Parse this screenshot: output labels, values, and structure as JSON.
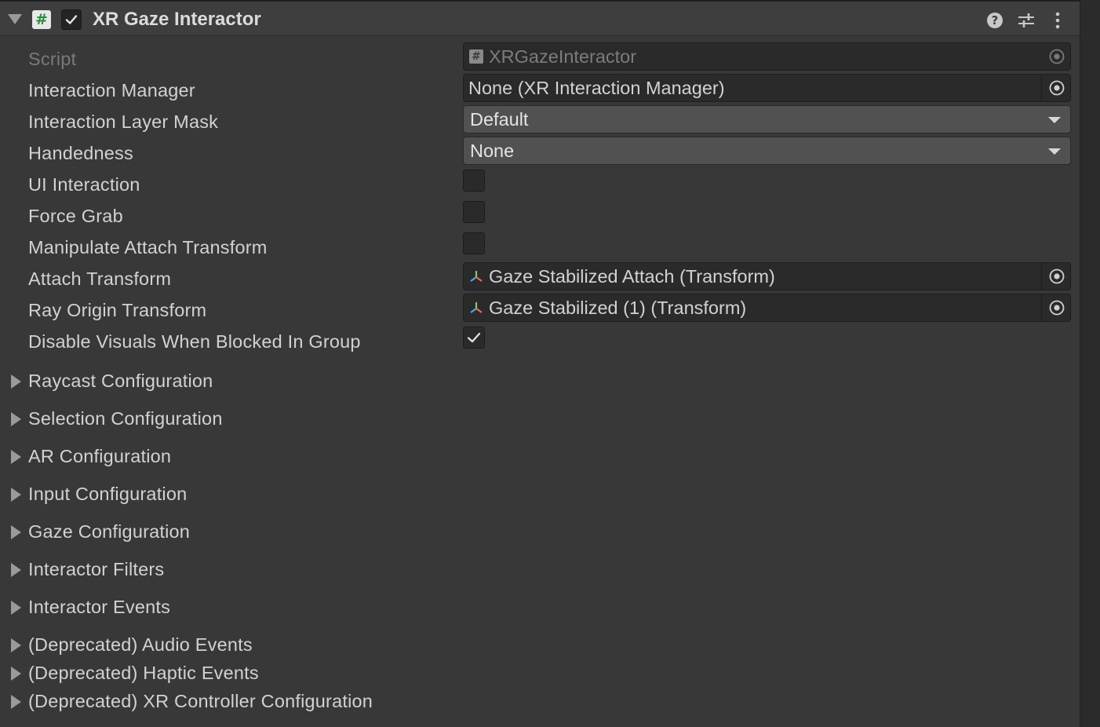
{
  "component": {
    "title": "XR Gaze Interactor",
    "icon": "csharp-script-icon",
    "enabled": true
  },
  "header_icons": [
    "help-icon",
    "presets-icon",
    "more-options-icon"
  ],
  "properties": [
    {
      "label": "Script",
      "value": "XRGazeInteractor",
      "kind": "object",
      "icon": "script-icon",
      "disabled": true
    },
    {
      "label": "Interaction Manager",
      "value": "None (XR Interaction Manager)",
      "kind": "object"
    },
    {
      "label": "Interaction Layer Mask",
      "value": "Default",
      "kind": "dropdown"
    },
    {
      "label": "Handedness",
      "value": "None",
      "kind": "dropdown"
    },
    {
      "label": "UI Interaction",
      "kind": "toggle",
      "checked": false
    },
    {
      "label": "Force Grab",
      "kind": "toggle",
      "checked": false
    },
    {
      "label": "Manipulate Attach Transform",
      "kind": "toggle",
      "checked": false
    },
    {
      "label": "Attach Transform",
      "value": "Gaze Stabilized Attach (Transform)",
      "kind": "object",
      "icon": "transform-icon"
    },
    {
      "label": "Ray Origin Transform",
      "value": "Gaze Stabilized (1) (Transform)",
      "kind": "object",
      "icon": "transform-icon"
    },
    {
      "label": "Disable Visuals When Blocked In Group",
      "kind": "toggle",
      "checked": true
    }
  ],
  "foldouts": [
    "Raycast Configuration",
    "Selection Configuration",
    "AR Configuration",
    "Input Configuration",
    "Gaze Configuration",
    "Interactor Filters",
    "Interactor Events",
    "(Deprecated) Audio Events",
    "(Deprecated) Haptic Events",
    "(Deprecated) XR Controller Configuration"
  ],
  "colors": {
    "panel_bg": "#383838",
    "header_bg": "#3e3e3e",
    "field_bg": "#2a2a2a",
    "dropdown_bg": "#515151",
    "text": "#d2d2d2",
    "disabled_text": "#7a7a7a",
    "script_icon_green": "#2b8a3e"
  }
}
